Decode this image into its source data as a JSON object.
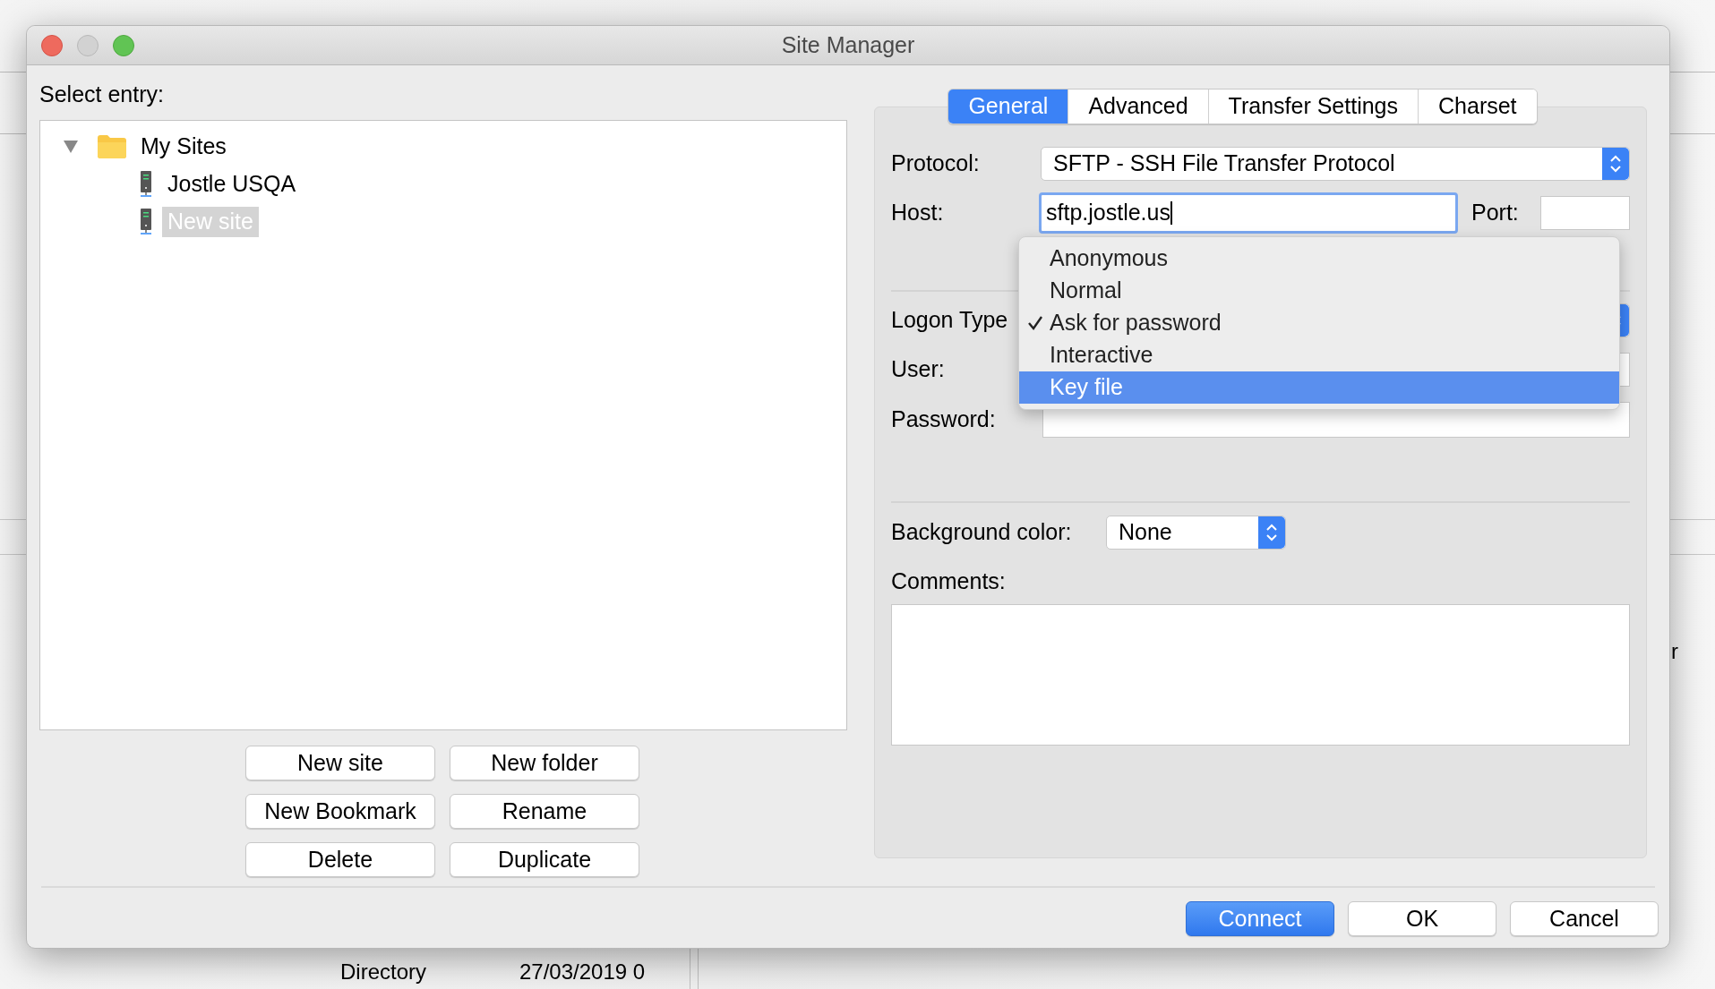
{
  "window": {
    "title": "Site Manager"
  },
  "tree": {
    "label": "Select entry:",
    "items": [
      {
        "label": "My Sites",
        "kind": "folder",
        "expanded": true,
        "selected": false,
        "children": [
          {
            "label": "Jostle USQA",
            "kind": "site",
            "selected": false
          },
          {
            "label": "New site",
            "kind": "site",
            "selected": true
          }
        ]
      }
    ]
  },
  "tree_buttons": [
    "New site",
    "New folder",
    "New Bookmark",
    "Rename",
    "Delete",
    "Duplicate"
  ],
  "tabs": [
    {
      "label": "General",
      "selected": true
    },
    {
      "label": "Advanced",
      "selected": false
    },
    {
      "label": "Transfer Settings",
      "selected": false
    },
    {
      "label": "Charset",
      "selected": false
    }
  ],
  "form": {
    "protocol": {
      "label": "Protocol:",
      "value": "SFTP - SSH File Transfer Protocol"
    },
    "host": {
      "label": "Host:",
      "value": "sftp.jostle.us"
    },
    "port": {
      "label": "Port:"
    },
    "logon_type": {
      "label": "Logon Type"
    },
    "user": {
      "label": "User:"
    },
    "password": {
      "label": "Password:"
    },
    "background_color": {
      "label": "Background color:",
      "value": "None"
    },
    "comments": {
      "label": "Comments:"
    }
  },
  "logon_menu": [
    {
      "label": "Anonymous",
      "checked": false,
      "selected": false
    },
    {
      "label": "Normal",
      "checked": false,
      "selected": false
    },
    {
      "label": "Ask for password",
      "checked": true,
      "selected": false
    },
    {
      "label": "Interactive",
      "checked": false,
      "selected": false
    },
    {
      "label": "Key file",
      "checked": false,
      "selected": true
    }
  ],
  "buttons": [
    {
      "label": "Connect",
      "kind": "default"
    },
    {
      "label": "OK",
      "kind": "plain"
    },
    {
      "label": "Cancel",
      "kind": "plain"
    }
  ],
  "background": {
    "texts": [
      "Directory",
      "27/03/2019 0",
      "r"
    ]
  }
}
